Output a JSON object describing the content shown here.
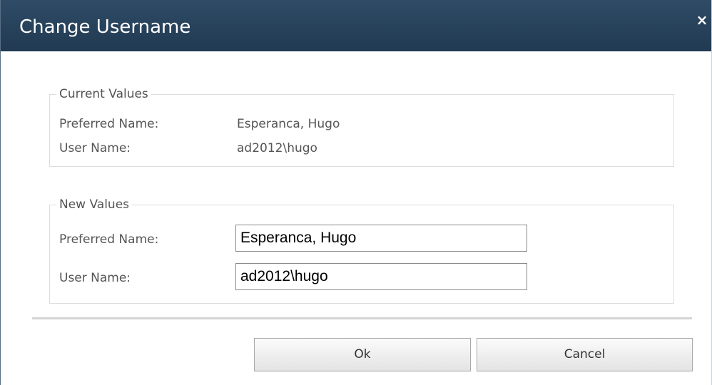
{
  "dialog": {
    "title": "Change Username",
    "close_symbol": "×"
  },
  "current_values": {
    "legend": "Current Values",
    "preferred_name_label": "Preferred Name:",
    "preferred_name_value": "Esperanca, Hugo",
    "user_name_label": "User Name:",
    "user_name_value": "ad2012\\hugo"
  },
  "new_values": {
    "legend": "New Values",
    "preferred_name_label": "Preferred Name:",
    "preferred_name_input": "Esperanca, Hugo",
    "user_name_label": "User Name:",
    "user_name_input": "ad2012\\hugo"
  },
  "buttons": {
    "ok_label": "Ok",
    "cancel_label": "Cancel"
  },
  "colors": {
    "titlebar": "#2b4560",
    "title_text": "#ffffff",
    "label_text": "#555555"
  }
}
